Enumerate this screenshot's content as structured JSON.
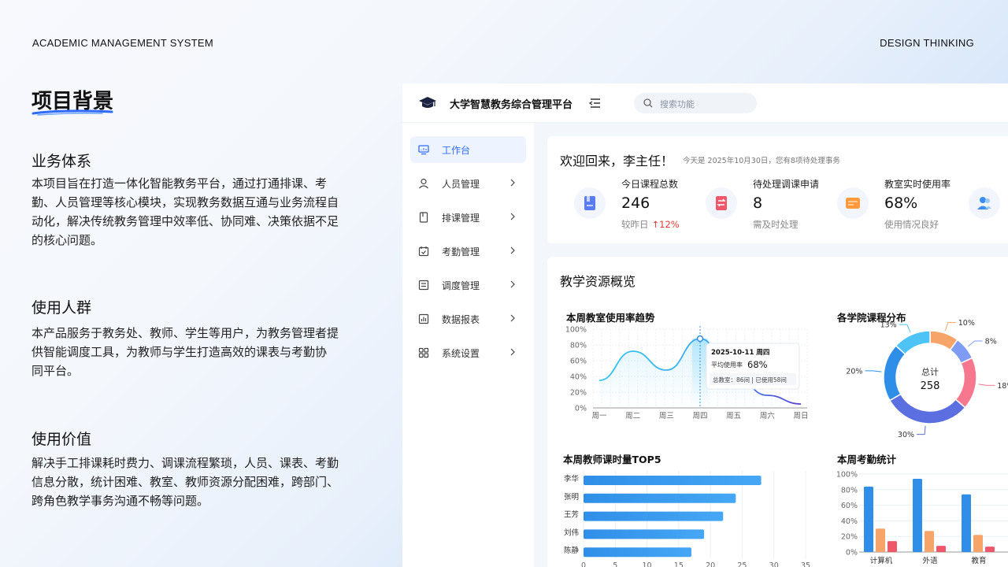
{
  "header": {
    "left": "ACADEMIC MANAGEMENT SYSTEM",
    "right": "DESIGN THINKING"
  },
  "intro": {
    "title": "项目背景",
    "sections": [
      {
        "heading": "业务体系",
        "lines": [
          "本项目旨在打造一体化智能教务平台，通过打通排课、考",
          "勤、人员管理等核心模块，实现教务数据互通与业务流程自",
          "动化，解决传统教务管理中效率低、协同难、决策依据不足",
          "的核心问题。"
        ]
      },
      {
        "heading": "使用人群",
        "lines": [
          "本产品服务于教务处、教师、学生等用户，为教务管理者提",
          "供智能调度工具，为教师与学生打造高效的课表与考勤协",
          "同平台。"
        ]
      },
      {
        "heading": "使用价值",
        "lines": [
          "解决手工排课耗时费力、调课流程繁琐，人员、课表、考勤",
          "信息分散，统计困难、教室、教师资源分配困难，跨部门、",
          "跨角色教学事务沟通不畅等问题。"
        ]
      }
    ]
  },
  "dashboard": {
    "title": "大学智慧教务综合管理平台",
    "search_placeholder": "搜索功能",
    "nav": [
      {
        "label": "工作台",
        "icon": "monitor-icon",
        "active": true
      },
      {
        "label": "人员管理",
        "icon": "user-icon"
      },
      {
        "label": "排课管理",
        "icon": "document-icon"
      },
      {
        "label": "考勤管理",
        "icon": "calendar-check-icon"
      },
      {
        "label": "调度管理",
        "icon": "list-icon"
      },
      {
        "label": "数据报表",
        "icon": "bar-chart-icon"
      },
      {
        "label": "系统设置",
        "icon": "grid-icon"
      }
    ],
    "welcome": {
      "title": "欢迎回来，李主任！",
      "subtitle": "今天是 2025年10月30日，您有8项待处理事务"
    },
    "stats": [
      {
        "label": "今日课程总数",
        "value": "246",
        "note": "较昨日",
        "change": "↑12%",
        "icon": "book-icon",
        "color": "#5b7cf0"
      },
      {
        "label": "待处理调课申请",
        "value": "8",
        "note": "需及时处理",
        "change": "",
        "icon": "swap-icon",
        "color": "#f0566a"
      },
      {
        "label": "教室实时使用率",
        "value": "68%",
        "note": "使用情况良好",
        "change": "",
        "icon": "card-icon",
        "color": "#ff9a3c"
      },
      {
        "label": "",
        "value": "",
        "note": "",
        "change": "",
        "icon": "users-icon",
        "color": "#3c8df0"
      }
    ],
    "resources_title": "教学资源概览",
    "accent": "#2f6bff"
  },
  "chart_data": [
    {
      "type": "line",
      "title": "本周教室使用率趋势",
      "categories": [
        "周一",
        "周二",
        "周三",
        "周四",
        "周五",
        "周六",
        "周日"
      ],
      "values": [
        35,
        72,
        48,
        88,
        42,
        16,
        5
      ],
      "ylim": [
        0,
        100
      ],
      "yticks": [
        "0%",
        "20%",
        "40%",
        "60%",
        "80%",
        "100%"
      ],
      "tooltip": {
        "date": "2025-10-11 周四",
        "label": "平均使用率",
        "value": "68%",
        "detail": "总教室：86间 | 已使用58间"
      }
    },
    {
      "type": "pie",
      "title": "各学院课程分布",
      "center_label": "总计",
      "center_value": "258",
      "labels": [
        "10%",
        "8%",
        "18%",
        "30%",
        "20%",
        "13%"
      ],
      "values": [
        10,
        8,
        18,
        30,
        20,
        13
      ],
      "colors": [
        "#f7a46b",
        "#7f9cf5",
        "#f7778f",
        "#5b6fe0",
        "#2f8fe8",
        "#4dc4f5"
      ]
    },
    {
      "type": "bar",
      "title": "本周教师课时量TOP5",
      "categories": [
        "李华",
        "张明",
        "王芳",
        "刘伟",
        "陈静"
      ],
      "values": [
        28,
        24,
        22,
        19,
        17
      ],
      "xticks": [
        "0",
        "5",
        "10",
        "15",
        "20",
        "25",
        "30",
        "35"
      ],
      "xlim": [
        0,
        35
      ]
    },
    {
      "type": "bar",
      "title": "本周考勤统计",
      "categories": [
        "计算机",
        "外语",
        "教育"
      ],
      "series": [
        {
          "values": [
            84,
            94,
            74
          ],
          "color": "#2f8fe8"
        },
        {
          "values": [
            30,
            27,
            22
          ],
          "color": "#f7a46b"
        },
        {
          "values": [
            14,
            8,
            7
          ],
          "color": "#f0566a"
        }
      ],
      "yticks": [
        "0%",
        "20%",
        "40%",
        "60%",
        "80%",
        "100%"
      ],
      "ylim": [
        0,
        100
      ]
    }
  ]
}
